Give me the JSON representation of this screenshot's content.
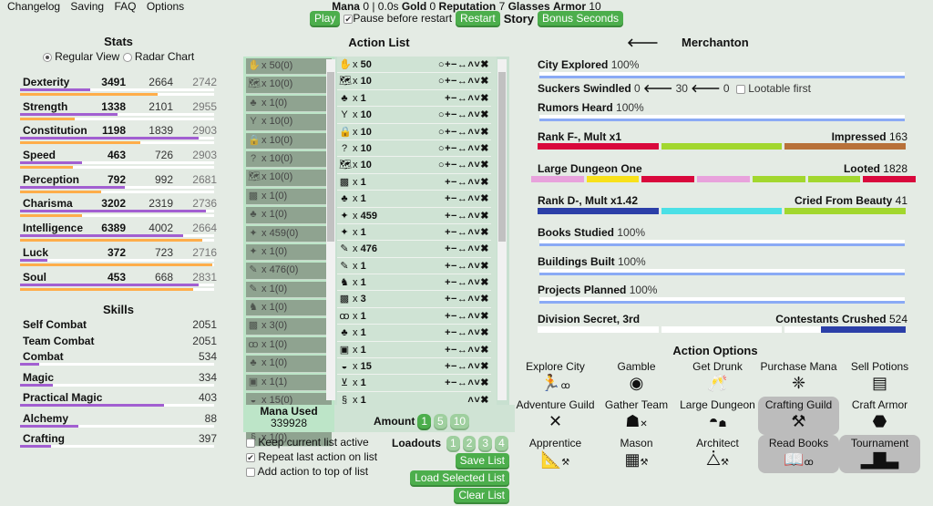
{
  "menu": [
    "Changelog",
    "Saving",
    "FAQ",
    "Options"
  ],
  "resources": {
    "mana_label": "Mana",
    "mana": "0",
    "time": "| 0.0s",
    "gold_label": "Gold",
    "gold": "0",
    "rep_label": "Reputation",
    "rep": "7",
    "glasses_label": "Glasses",
    "armor_label": "Armor",
    "armor": "10"
  },
  "controls": {
    "play": "Play",
    "pause_label": "Pause before restart",
    "pause_checked": true,
    "restart": "Restart",
    "story": "Story",
    "bonus": "Bonus Seconds"
  },
  "stats": {
    "title": "Stats",
    "view_regular": "Regular View",
    "view_radar": "Radar Chart",
    "selected_view": "Regular View",
    "items": [
      {
        "name": "Dexterity",
        "level": "3491",
        "talent": "2664",
        "soul": "2742",
        "progress": 0.36,
        "talent_progress": 0.71
      },
      {
        "name": "Strength",
        "level": "1338",
        "talent": "2101",
        "soul": "2955",
        "progress": 0.5,
        "talent_progress": 0.28
      },
      {
        "name": "Constitution",
        "level": "1198",
        "talent": "1839",
        "soul": "2903",
        "progress": 0.92,
        "talent_progress": 0.62
      },
      {
        "name": "Speed",
        "level": "463",
        "talent": "726",
        "soul": "2903",
        "progress": 0.32,
        "talent_progress": 0.27
      },
      {
        "name": "Perception",
        "level": "792",
        "talent": "992",
        "soul": "2681",
        "progress": 0.54,
        "talent_progress": 0.42
      },
      {
        "name": "Charisma",
        "level": "3202",
        "talent": "2319",
        "soul": "2736",
        "progress": 0.96,
        "talent_progress": 0.32
      },
      {
        "name": "Intelligence",
        "level": "6389",
        "talent": "4002",
        "soul": "2664",
        "progress": 0.84,
        "talent_progress": 0.94
      },
      {
        "name": "Luck",
        "level": "372",
        "talent": "723",
        "soul": "2716",
        "progress": 0.14,
        "talent_progress": 0.99
      },
      {
        "name": "Soul",
        "level": "453",
        "talent": "668",
        "soul": "2831",
        "progress": 0.92,
        "talent_progress": 0.89
      }
    ]
  },
  "skills": {
    "title": "Skills",
    "items": [
      {
        "name": "Self Combat",
        "value": "2051",
        "bar": false
      },
      {
        "name": "Team Combat",
        "value": "2051",
        "bar": false
      },
      {
        "name": "Combat",
        "value": "534",
        "bar": true,
        "progress": 0.1
      },
      {
        "name": "Magic",
        "value": "334",
        "bar": true,
        "progress": 0.17
      },
      {
        "name": "Practical Magic",
        "value": "403",
        "bar": true,
        "progress": 0.74
      },
      {
        "name": "Alchemy",
        "value": "88",
        "bar": true,
        "progress": 0.3
      },
      {
        "name": "Crafting",
        "value": "397",
        "bar": true,
        "progress": 0.16
      }
    ]
  },
  "action_list": {
    "title": "Action List",
    "rows": [
      {
        "icon": "✋",
        "icon_name": "hand-icon",
        "left": "50(0)",
        "right": "50",
        "circle": true,
        "full_ctl": true
      },
      {
        "icon": "🗺",
        "icon_name": "map-icon",
        "left": "10(0)",
        "right": "10",
        "circle": true,
        "full_ctl": true
      },
      {
        "icon": "♣",
        "icon_name": "gem-icon",
        "left": "1(0)",
        "right": "1",
        "circle": false,
        "full_ctl": true
      },
      {
        "icon": "Y",
        "icon_name": "slingshot-icon",
        "left": "10(0)",
        "right": "10",
        "circle": true,
        "full_ctl": true
      },
      {
        "icon": "🔒",
        "icon_name": "lock-icon",
        "left": "10(0)",
        "right": "10",
        "circle": true,
        "full_ctl": true
      },
      {
        "icon": "?",
        "icon_name": "mystery-map-icon",
        "left": "10(0)",
        "right": "10",
        "circle": true,
        "full_ctl": true
      },
      {
        "icon": "🗺",
        "icon_name": "map-icon",
        "left": "10(0)",
        "right": "10",
        "circle": true,
        "full_ctl": true
      },
      {
        "icon": "▩",
        "icon_name": "market-icon",
        "left": "1(0)",
        "right": "1",
        "circle": false,
        "full_ctl": true
      },
      {
        "icon": "♣",
        "icon_name": "gem-icon",
        "left": "1(0)",
        "right": "1",
        "circle": false,
        "full_ctl": true
      },
      {
        "icon": "✦",
        "icon_name": "fairy-icon",
        "left": "459(0)",
        "right": "459",
        "circle": false,
        "full_ctl": true
      },
      {
        "icon": "✦",
        "icon_name": "fairy-icon",
        "left": "1(0)",
        "right": "1",
        "circle": false,
        "full_ctl": true
      },
      {
        "icon": "✎",
        "icon_name": "wand-icon",
        "left": "476(0)",
        "right": "476",
        "circle": false,
        "full_ctl": true
      },
      {
        "icon": "✎",
        "icon_name": "wand-icon",
        "left": "1(0)",
        "right": "1",
        "circle": false,
        "full_ctl": true
      },
      {
        "icon": "♞",
        "icon_name": "person-icon",
        "left": "1(0)",
        "right": "1",
        "circle": false,
        "full_ctl": true
      },
      {
        "icon": "▩",
        "icon_name": "market-icon",
        "left": "3(0)",
        "right": "3",
        "circle": false,
        "full_ctl": true
      },
      {
        "icon": "ꝏ",
        "icon_name": "glasses-icon",
        "left": "1(0)",
        "right": "1",
        "circle": false,
        "full_ctl": true
      },
      {
        "icon": "♣",
        "icon_name": "gem-icon",
        "left": "1(0)",
        "right": "1",
        "circle": false,
        "full_ctl": true
      },
      {
        "icon": "▣",
        "icon_name": "guild-icon",
        "left": "1(1)",
        "right": "1",
        "circle": false,
        "full_ctl": true
      },
      {
        "icon": "◒",
        "icon_name": "handshake-icon",
        "left": "15(0)",
        "right": "15",
        "circle": false,
        "full_ctl": true
      },
      {
        "icon": "⊻",
        "icon_name": "cart-icon",
        "left": "1(0)",
        "right": "1",
        "circle": false,
        "full_ctl": true
      },
      {
        "icon": "§",
        "icon_name": "snake-icon",
        "left": "1(0)",
        "right": "1",
        "circle": false,
        "full_ctl": false
      }
    ],
    "ctl_full": "+−↔˄˅✖",
    "ctl_short": "˄˅✖",
    "mana_used_label": "Mana Used",
    "mana_used": "339928",
    "amount_label": "Amount",
    "amounts": [
      "1",
      "5",
      "10"
    ],
    "amount_selected": "1"
  },
  "list_options": {
    "keep_active": {
      "label": "Keep current list active",
      "checked": false
    },
    "repeat_last": {
      "label": "Repeat last action on list",
      "checked": true
    },
    "add_top": {
      "label": "Add action to top of list",
      "checked": false
    }
  },
  "loadouts": {
    "label": "Loadouts",
    "slots": [
      "1",
      "2",
      "3",
      "4"
    ],
    "save": "Save List",
    "load": "Load Selected List",
    "clear": "Clear List"
  },
  "town": {
    "back_arrow": "🡐",
    "name": "Merchanton",
    "progress": [
      {
        "label": "City Explored",
        "value": "100%",
        "fraction": 1.0
      },
      {
        "label": "Rumors Heard",
        "value": "100%",
        "fraction": 1.0
      },
      {
        "label": "Books Studied",
        "value": "100%",
        "fraction": 1.0
      },
      {
        "label": "Buildings Built",
        "value": "100%",
        "fraction": 1.0
      },
      {
        "label": "Projects Planned",
        "value": "100%",
        "fraction": 1.0
      }
    ],
    "swindle": {
      "label": "Suckers Swindled",
      "a": "0",
      "b": "30",
      "c": "0",
      "arrow": "🡐",
      "lootable_label": "Lootable first",
      "lootable_checked": false
    },
    "multipart": [
      {
        "left": "Rank F-, Mult x1",
        "right_label": "Impressed",
        "right_value": "163",
        "segments": [
          "#d9083c",
          "#a2d72e",
          "#b87139"
        ]
      },
      {
        "left": "Large Dungeon One",
        "right_label": "Looted",
        "right_value": "1828",
        "segments": [
          "#e8a2dc",
          "#f8e11a",
          "#d9083c",
          "#e8a2dc",
          "#a2d72e",
          "#a2d72e",
          "#d9083c"
        ]
      },
      {
        "left": "Rank D-, Mult x1.42",
        "right_label": "Cried From Beauty",
        "right_value": "41",
        "segments": [
          "#2b3fa8",
          "#4be0e6",
          "#a2d72e"
        ]
      },
      {
        "left": "Division Secret, 3rd",
        "right_label": "Contestants Crushed",
        "right_value": "524",
        "segments": [
          "#ffffff",
          "#ffffff",
          "#ffffff"
        ],
        "last_fill_fraction": 0.7,
        "last_fill_color": "#2b3fa8"
      }
    ]
  },
  "action_options": {
    "title": "Action Options",
    "items": [
      {
        "label": "Explore City",
        "icon": "🏃",
        "icon_name": "running-icon",
        "sub": "ꝏ",
        "selected": false
      },
      {
        "label": "Gamble",
        "icon": "◉",
        "icon_name": "chip-icon",
        "sub": "",
        "selected": false
      },
      {
        "label": "Get Drunk",
        "icon": "🥂",
        "icon_name": "drink-icon",
        "sub": "",
        "selected": false
      },
      {
        "label": "Purchase Mana",
        "icon": "❈",
        "icon_name": "crystal-icon",
        "sub": "",
        "selected": false
      },
      {
        "label": "Sell Potions",
        "icon": "▤",
        "icon_name": "stall-icon",
        "sub": "",
        "selected": false
      },
      {
        "label": "Adventure Guild",
        "icon": "✕",
        "icon_name": "crossed-swords-icon",
        "sub": "",
        "selected": false
      },
      {
        "label": "Gather Team",
        "icon": "☗",
        "icon_name": "team-icon",
        "sub": "✕",
        "selected": false
      },
      {
        "label": "Large Dungeon",
        "icon": "◓",
        "icon_name": "dungeon-icon",
        "sub": "☗",
        "selected": false
      },
      {
        "label": "Crafting Guild",
        "icon": "⚒",
        "icon_name": "anvil-icon",
        "sub": "",
        "selected": true
      },
      {
        "label": "Craft Armor",
        "icon": "⬣",
        "icon_name": "armor-icon",
        "sub": "",
        "selected": false
      },
      {
        "label": "Apprentice",
        "icon": "📐",
        "icon_name": "ruler-icon",
        "sub": "⚒",
        "selected": false
      },
      {
        "label": "Mason",
        "icon": "▦",
        "icon_name": "bricks-icon",
        "sub": "⚒",
        "selected": false
      },
      {
        "label": "Architect",
        "icon": "⧊",
        "icon_name": "compass-icon",
        "sub": "⚒",
        "selected": false
      },
      {
        "label": "Read Books",
        "icon": "📖",
        "icon_name": "reading-icon",
        "sub": "ꝏ",
        "selected": true
      },
      {
        "label": "Tournament",
        "icon": "▂▇▃",
        "icon_name": "podium-icon",
        "sub": "",
        "selected": true
      }
    ]
  }
}
